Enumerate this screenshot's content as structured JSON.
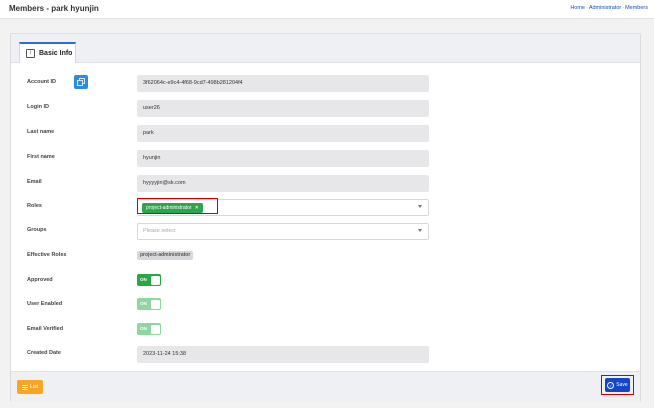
{
  "header": {
    "title": "Members - park hyunjin",
    "breadcrumb": [
      "Home",
      "Administrator",
      "Members"
    ]
  },
  "tabs": [
    {
      "label": "Basic Info",
      "icon": "info-icon"
    }
  ],
  "form": {
    "account_id": {
      "label": "Account ID",
      "value": "3f62064c-e9c4-4f68-9cd7-498b281204f4",
      "action_icon": "copy-icon"
    },
    "login_id": {
      "label": "Login ID",
      "value": "user26"
    },
    "last_name": {
      "label": "Last name",
      "value": "park"
    },
    "first_name": {
      "label": "First name",
      "value": "hyunjin"
    },
    "email": {
      "label": "Email",
      "value": "hyyyyjin@sk.com"
    },
    "roles": {
      "label": "Roles",
      "selected": [
        "project-administrator"
      ]
    },
    "groups": {
      "label": "Groups",
      "placeholder": "Please select"
    },
    "effective_roles": {
      "label": "Effective Roles",
      "values": [
        "project-administrator"
      ]
    },
    "approved": {
      "label": "Approved",
      "state": "ON",
      "enabled": true
    },
    "user_enabled": {
      "label": "User Enabled",
      "state": "ON",
      "enabled": true
    },
    "email_verified": {
      "label": "Email Verified",
      "state": "ON",
      "enabled": true
    },
    "created_date": {
      "label": "Created Date",
      "value": "2023-11-24 15:38"
    }
  },
  "footer": {
    "list_label": "List",
    "save_label": "Save"
  },
  "colors": {
    "accent": "#2f6ad9",
    "toggle_on": "#28a745",
    "toggle_on_muted": "#8fd6a0",
    "list_button": "#f6a623",
    "save_button": "#1546c8",
    "highlight": "#d00000"
  }
}
